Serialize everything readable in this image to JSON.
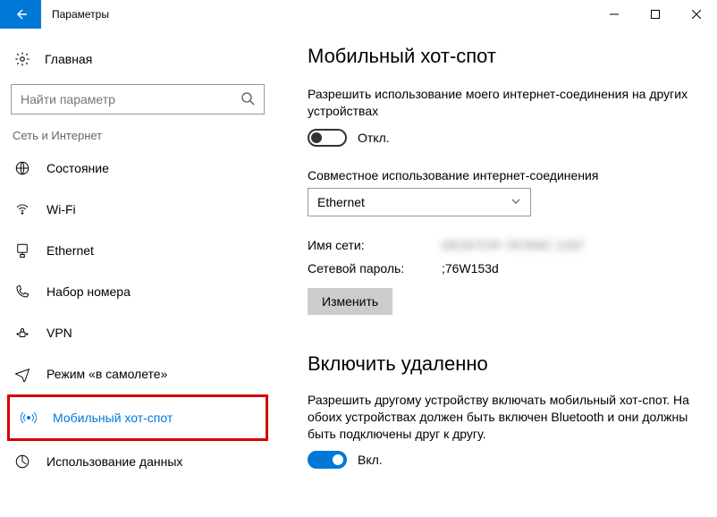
{
  "window": {
    "title": "Параметры"
  },
  "sidebar": {
    "home": "Главная",
    "search_placeholder": "Найти параметр",
    "category": "Сеть и Интернет",
    "items": [
      {
        "label": "Состояние"
      },
      {
        "label": "Wi-Fi"
      },
      {
        "label": "Ethernet"
      },
      {
        "label": "Набор номера"
      },
      {
        "label": "VPN"
      },
      {
        "label": "Режим «в самолете»"
      },
      {
        "label": "Мобильный хот-спот"
      },
      {
        "label": "Использование данных"
      }
    ]
  },
  "main": {
    "heading": "Мобильный хот-спот",
    "share_desc": "Разрешить использование моего интернет-соединения на других устройствах",
    "share_toggle": "Откл.",
    "share_from_label": "Совместное использование интернет-соединения",
    "share_from_value": "Ethernet",
    "net_name_label": "Имя сети:",
    "net_name_value": "DESKTOP-7679MC 1297",
    "net_pass_label": "Сетевой пароль:",
    "net_pass_value": ";76W153d",
    "edit_button": "Изменить",
    "remote_heading": "Включить удаленно",
    "remote_desc": "Разрешить другому устройству включать мобильный хот-спот. На обоих устройствах должен быть включен Bluetooth и они должны быть подключены друг к другу.",
    "remote_toggle": "Вкл."
  }
}
